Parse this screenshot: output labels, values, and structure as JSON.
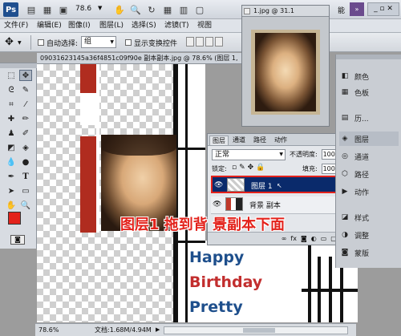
{
  "appbar": {
    "logo": "Ps",
    "zoom_value": "78.6",
    "essentials": "能"
  },
  "menu": [
    "文件(F)",
    "编辑(E)",
    "图像(I)",
    "图层(L)",
    "选择(S)",
    "滤镜(T)",
    "视图"
  ],
  "options": {
    "auto_select_label": "自动选择:",
    "auto_select_value": "组",
    "show_transform_label": "显示变换控件"
  },
  "document": {
    "tab_title": "09031623145a36f4851c09f90e 副本副本.jpg @ 78.6% (图层 1,"
  },
  "photo_window": {
    "title": "1.jpg @ 31.1"
  },
  "layers_panel": {
    "tabs": [
      "图层",
      "通道",
      "路径",
      "动作"
    ],
    "blend_mode": "正常",
    "opacity_label": "不透明度:",
    "opacity_value": "100%",
    "lock_label": "锁定:",
    "fill_label": "填充:",
    "fill_value": "100%",
    "layers": [
      {
        "name": "图层 1",
        "selected": true
      },
      {
        "name": "背景 副本",
        "selected": false
      }
    ]
  },
  "dock": {
    "items": [
      "颜色",
      "色板",
      "历...",
      "图层",
      "通道",
      "路径",
      "动作",
      "样式",
      "调整",
      "蒙版"
    ]
  },
  "annotation": "图层1 拖到背 景副本下面",
  "canvas_text": [
    "Happy",
    "Birthday",
    "Pretty"
  ],
  "status": {
    "zoom": "78.6%",
    "doc_size": "文档:1.68M/4.94M"
  },
  "colors": {
    "accent_red": "#e3221b",
    "selection_blue": "#0a2a6b",
    "happy_blue": "#1e4f8c",
    "birthday_red": "#c22e2e"
  }
}
